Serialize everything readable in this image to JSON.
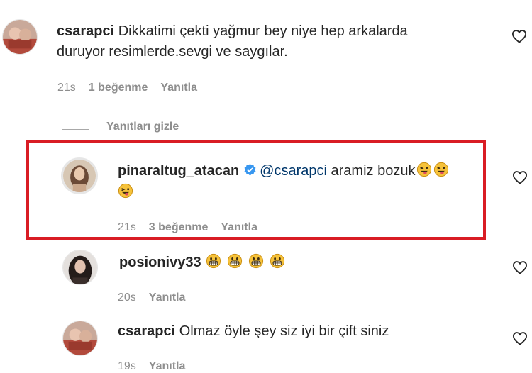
{
  "comments": [
    {
      "username": "csarapci",
      "text_line1": "Dikkatimi çekti yağmur bey niye hep arkalarda",
      "text_line2": "duruyor resimlerde.sevgi ve saygılar.",
      "time": "21s",
      "likes": "1 beğenme",
      "reply": "Yanıtla"
    }
  ],
  "hide_replies": "Yanıtları gizle",
  "replies": [
    {
      "username": "pinaraltug_atacan",
      "verified": true,
      "mention": "@csarapci",
      "text": " aramiz bozuk",
      "time": "21s",
      "likes": "3 beğenme",
      "reply": "Yanıtla"
    },
    {
      "username": "posionivy33",
      "time": "20s",
      "reply": "Yanıtla"
    },
    {
      "username": "csarapci",
      "text": "Olmaz öyle şey siz iyi bir çift siniz",
      "time": "19s",
      "reply": "Yanıtla"
    }
  ],
  "colors": {
    "highlight": "#d91c24",
    "verified": "#3897f0",
    "mention": "#00376b",
    "meta": "#8e8e8e"
  },
  "icons": [
    "heart-icon",
    "verified-badge-icon",
    "winking-tongue-emoji",
    "grinning-emoji"
  ]
}
